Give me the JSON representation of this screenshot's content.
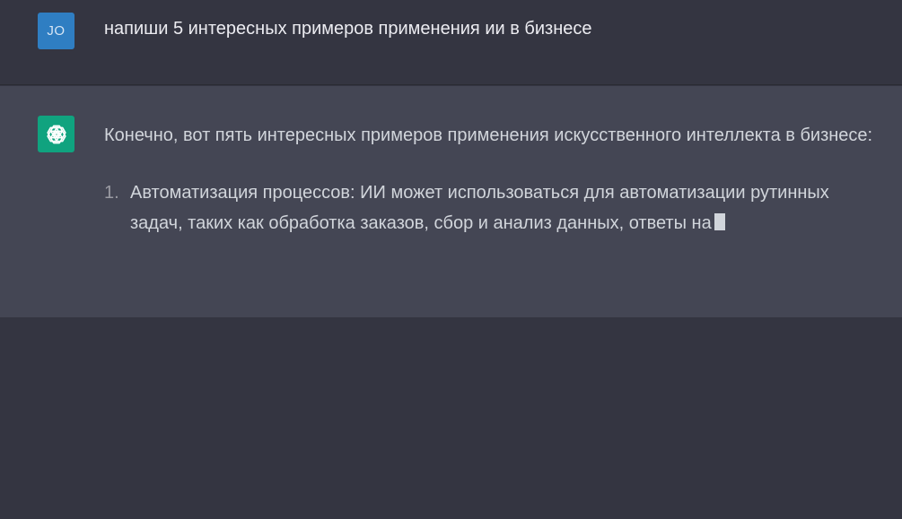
{
  "user_message": {
    "avatar_initials": "JO",
    "text": "напиши 5 интересных примеров применения ии в бизнесе"
  },
  "assistant_message": {
    "avatar_icon": "openai-logo-icon",
    "intro": "Конечно, вот пять интересных примеров применения искусственного интеллекта в бизнесе:",
    "items": [
      {
        "number": "1.",
        "text": "Автоматизация процессов: ИИ может использоваться для автоматизации рутинных задач, таких как обработка заказов, сбор и анализ данных, ответы на"
      }
    ]
  },
  "colors": {
    "page_bg": "#343541",
    "assistant_bg": "#444654",
    "user_avatar_bg": "#2f7ec2",
    "assistant_avatar_bg": "#10a37f",
    "text": "#d1d5db"
  }
}
